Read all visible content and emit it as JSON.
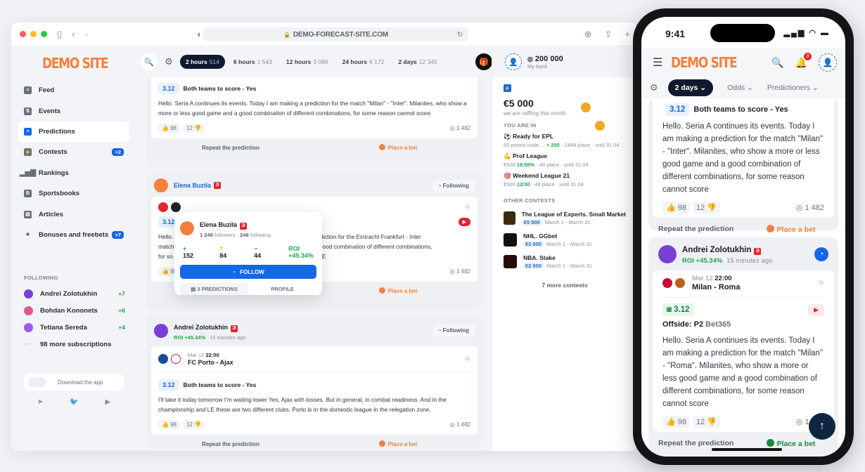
{
  "browser": {
    "url": "DEMO-FORECAST-SITE.COM",
    "traffic_lights": [
      "#ff5f57",
      "#febc2e",
      "#28c840"
    ]
  },
  "brand": {
    "logo": "DEMO SITE",
    "accent": "#f5803e",
    "primary": "#1467e6"
  },
  "sidebar": {
    "items": [
      {
        "label": "Feed",
        "icon": "feed-icon"
      },
      {
        "label": "Events",
        "icon": "events-icon"
      },
      {
        "label": "Predictions",
        "icon": "predictions-icon",
        "active": true
      },
      {
        "label": "Contests",
        "icon": "contests-icon",
        "badge": "+2"
      },
      {
        "label": "Rankings",
        "icon": "rankings-icon"
      },
      {
        "label": "Sportsbooks",
        "icon": "sportsbooks-icon"
      },
      {
        "label": "Articles",
        "icon": "articles-icon"
      },
      {
        "label": "Bonuses and freebets",
        "icon": "gift-icon",
        "badge": "+7"
      }
    ],
    "following_heading": "FOLLOWING",
    "following": [
      {
        "name": "Andrei Zolotukhin",
        "count": "+7"
      },
      {
        "name": "Bohdan Kononets",
        "count": "+6"
      },
      {
        "name": "Tetiana Sereda",
        "count": "+4"
      }
    ],
    "more_subscriptions": "98 more subscriptions",
    "download_app": "Download the app"
  },
  "topbar": {
    "tabs": [
      {
        "label": "2 hours",
        "count": "514",
        "active": true
      },
      {
        "label": "6 hours",
        "count": "1 543"
      },
      {
        "label": "12 hours",
        "count": "3 086"
      },
      {
        "label": "24 hours",
        "count": "6 172"
      },
      {
        "label": "2 days",
        "count": "12 345"
      }
    ]
  },
  "feed": {
    "repeat_label": "Repeat the prediction",
    "bet_label": "Place a bet",
    "following_label": "Following",
    "cards": [
      {
        "odds": "3.12",
        "pick": "Both teams to score - Yes",
        "text": "Hello. Seria A continues its events. Today I am making a prediction for the match \"Milan\" - \"Inter\". Milanites, who show a more or less good game and a good combination of different combinations, for some reason cannot score",
        "likes": "98",
        "dislikes": "12",
        "views": "1 482"
      },
      {
        "author": "Elena Buzila",
        "odds": "3.12",
        "text_line1": "Hello.",
        "text_right1": "ng a prediction for the Eintracht Frankfurt - Inter",
        "text_line2": "match",
        "text_right2": "e and a good combination of different combinations,",
        "text_line3": "for so",
        "text_right3": "ТАТЬ ВСЕ",
        "likes": "98",
        "dislikes": "12",
        "views": "1 482"
      },
      {
        "author": "Andrei Zolotukhin",
        "roi": "ROI +45.34%",
        "time": "15 minutes ago",
        "date": "Mar 12",
        "kickoff": "22:00",
        "teams": "FC Porto  -  Ajax",
        "odds": "3.12",
        "pick": "Both teams to score - Yes",
        "text": "I'll take it today tomorrow I'm waiting lower Yes, Ajax with losses. But in general, in combat readiness. And in the championship and LE these are two different clubs. Porto is in the domestic league in the relegation zone.",
        "likes": "98",
        "dislikes": "12",
        "views": "1 482"
      }
    ]
  },
  "popup": {
    "name": "Elena Buzila",
    "followers": "1 248",
    "followers_label": "followers",
    "following": "248",
    "following_label": "following",
    "wins": "152",
    "draws": "84",
    "losses": "44",
    "roi": "ROI +45.34%",
    "follow_label": "FOLLOW",
    "predictions_label": "3 PREDICTIONS",
    "profile_label": "PROFILE"
  },
  "right": {
    "bank_amount": "200 000",
    "bank_label": "My bank",
    "prize": "€5 000",
    "prize_sub": "we are raffling this month",
    "you_are_in": "YOU ARE IN",
    "my_contests": [
      {
        "title": "Ready for EPL",
        "meta": "50 promo code..",
        "score": "+ 200",
        "place": "2448 place",
        "until": "until 31.04"
      },
      {
        "title": "Prof League",
        "meta": "€500",
        "score": "19,58%",
        "place": "48 place",
        "until": "until 31.04"
      },
      {
        "title": "Weekend League 21",
        "meta": "€500",
        "score": "12/30",
        "place": "48 place",
        "until": "until 31.04"
      }
    ],
    "other_heading": "OTHER CONTESTS",
    "other_contests": [
      {
        "title": "The League of Experts. Small Market",
        "prize": "€5 000",
        "dates": "March 1 - March 31"
      },
      {
        "title": "NHL. GGbet",
        "prize": "€3 000",
        "dates": "March 1 - March 31"
      },
      {
        "title": "NBA. Stake",
        "prize": "€2 000",
        "dates": "March 1 - March 31"
      }
    ],
    "more_contests": "7 more contests"
  },
  "phone": {
    "time": "9:41",
    "logo": "DEMO SITE",
    "notifications": "3",
    "filter_days": "2 days",
    "filter_odds": "Odds",
    "filter_predictioners": "Predictioners",
    "card1": {
      "odds": "3.12",
      "pick": "Both teams to score - Yes",
      "text": "Hello. Seria A continues its events. Today I am making a prediction for the match \"Milan\" - \"Inter\". Milanites, who show a more or less good game and a good combination of different combinations, for some reason cannot score",
      "likes": "98",
      "dislikes": "12",
      "views": "1 482"
    },
    "card2": {
      "author": "Andrei Zolotukhin",
      "roi": "ROI +45.34%",
      "time": "15 minutes ago",
      "date": "Mar 12",
      "kickoff": "22:00",
      "teams": "Milan  -  Roma",
      "odds": "3.12",
      "pick": "Offside: P2",
      "bookmaker": "Bet365",
      "text": "Hello. Seria A continues its events. Today I am making a prediction for the match \"Milan\" - \"Roma\". Milanites, who show a more or less good game and a good combination of different combinations, for some reason cannot score",
      "likes": "98",
      "dislikes": "12",
      "views": "1 482"
    },
    "repeat_label": "Repeat the prediction",
    "bet_label": "Place a bet"
  }
}
